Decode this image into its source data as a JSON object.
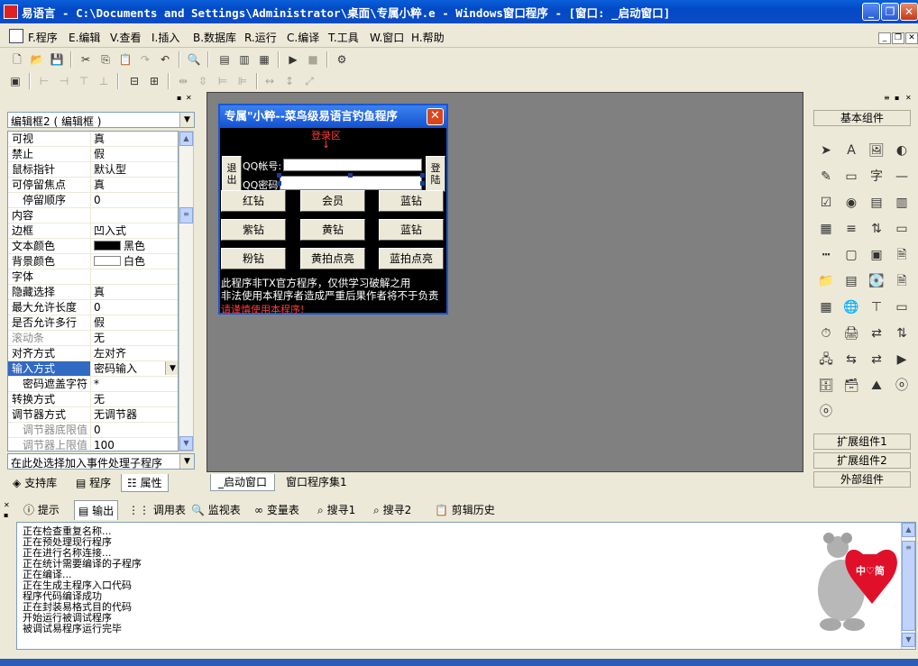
{
  "window": {
    "title": "易语言 - C:\\Documents and Settings\\Administrator\\桌面\\专属小粹.e - Windows窗口程序 - [窗口: _启动窗口]",
    "min_label": "_",
    "max_label": "❐",
    "close_label": "✕"
  },
  "menu": {
    "items": [
      "F.程序",
      "E.编辑",
      "V.查看",
      "I.插入",
      "B.数据库",
      "R.运行",
      "C.编译",
      "T.工具",
      "W.窗口",
      "H.帮助"
    ]
  },
  "left_panel": {
    "selector": "编辑框2 ( 编辑框 )",
    "properties": [
      {
        "name": "可视",
        "value": "真"
      },
      {
        "name": "禁止",
        "value": "假"
      },
      {
        "name": "鼠标指针",
        "value": "默认型"
      },
      {
        "name": "可停留焦点",
        "value": "真"
      },
      {
        "name": "停留顺序",
        "value": "0"
      },
      {
        "name": "内容",
        "value": ""
      },
      {
        "name": "边框",
        "value": "凹入式"
      },
      {
        "name": "文本颜色",
        "value": "黑色"
      },
      {
        "name": "背景颜色",
        "value": "白色"
      },
      {
        "name": "字体",
        "value": ""
      },
      {
        "name": "隐藏选择",
        "value": "真"
      },
      {
        "name": "最大允许长度",
        "value": "0"
      },
      {
        "name": "是否允许多行",
        "value": "假"
      },
      {
        "name": "滚动条",
        "value": "无"
      },
      {
        "name": "对齐方式",
        "value": "左对齐"
      },
      {
        "name": "输入方式",
        "value": "密码输入"
      },
      {
        "name": "密码遮盖字符",
        "value": "*"
      },
      {
        "name": "转换方式",
        "value": "无"
      },
      {
        "name": "调节器方式",
        "value": "无调节器"
      },
      {
        "name": "调节器底限值",
        "value": "0"
      },
      {
        "name": "调节器上限值",
        "value": "100"
      }
    ],
    "event_selector": "在此处选择加入事件处理子程序",
    "tabs": [
      "支持库",
      "程序",
      "属性"
    ],
    "colors": {
      "text_color": "#000000",
      "bg_color": "#ffffff",
      "selection": "#316ac5"
    }
  },
  "form": {
    "title": "专属\"小粹--菜鸟级易语言钓鱼程序",
    "login_area": "登录区",
    "arrow": "↓",
    "exit_button": "退出",
    "login_button": "登陆",
    "qq_label": "QQ帐号:",
    "pwd_label": "QQ密码",
    "buttons": [
      "红钻",
      "会员",
      "蓝钻",
      "紫钻",
      "黄钻",
      "蓝钻",
      "粉钻",
      "黄拍点亮",
      "蓝拍点亮"
    ],
    "notice1": "此程序非TX官方程序，仅供学习破解之用",
    "notice2": "非法使用本程序者造成严重后果作者将不于负责",
    "warning": "请谨慎使用本程序!"
  },
  "sheet_tabs": [
    "_启动窗口",
    "窗口程序集1"
  ],
  "right_panel": {
    "basic_label": "基本组件",
    "ext1_label": "扩展组件1",
    "ext2_label": "扩展组件2",
    "external_label": "外部组件",
    "icons": [
      "pointer-icon",
      "label-icon",
      "picture-icon",
      "shape-icon",
      "edit-icon",
      "groupbox-icon",
      "text-icon",
      "line-icon",
      "checkbox-icon",
      "radio-icon",
      "listbox-icon",
      "combobox-icon",
      "grid-icon",
      "scroll-icon",
      "spin-icon",
      "progress-icon",
      "ruler-icon",
      "panel-icon",
      "tab-icon",
      "filebox-icon",
      "dirbox-icon",
      "textbox-icon",
      "drive-icon",
      "doc-icon",
      "table-icon",
      "globe-icon",
      "slider-icon",
      "frame-icon",
      "timer-icon",
      "printer-icon",
      "data-icon",
      "netlink-icon",
      "client-icon",
      "socket-icon",
      "dde-icon",
      "media-icon",
      "db-icon",
      "dbsource-icon",
      "chart-icon",
      "odbc-icon",
      "odbc2-icon"
    ]
  },
  "output_panel": {
    "tabs": [
      "提示",
      "输出",
      "调用表",
      "监视表",
      "变量表",
      "搜寻1",
      "搜寻2",
      "剪辑历史"
    ],
    "lines": [
      "正在检查重复名称...",
      "正在预处理现行程序",
      "正在进行名称连接...",
      "正在统计需要编译的子程序",
      "正在编译...",
      "正在生成主程序入口代码",
      "程序代码编译成功",
      "正在封装易格式目的代码",
      "开始运行被调试程序",
      "被调试易程序运行完毕"
    ],
    "mascot_text": "中♡简"
  }
}
